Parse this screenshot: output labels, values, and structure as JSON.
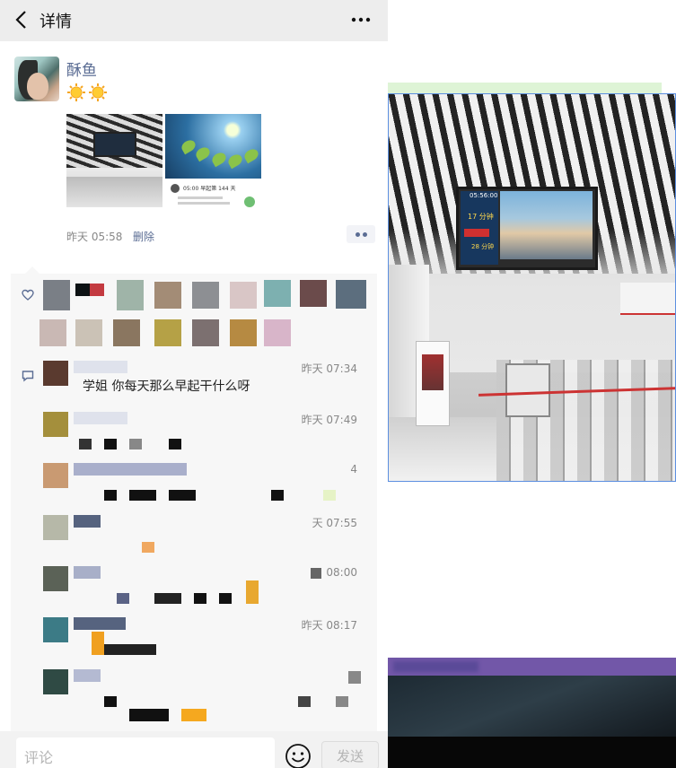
{
  "nav": {
    "title": "详情"
  },
  "post": {
    "username": "酥鱼",
    "time": "昨天 05:58",
    "delete_label": "删除",
    "image2_caption": "05:00 早起第 144 天"
  },
  "viewer": {
    "tv_clock": "05:56:00",
    "tv_minutes": "17 分钟",
    "tv_minutes2": "28 分钟"
  },
  "comments": [
    {
      "time": "昨天 07:34",
      "text": "学姐 你每天那么早起干什么呀"
    },
    {
      "time": "昨天 07:49",
      "text": ""
    },
    {
      "time": "4",
      "text": ""
    },
    {
      "time": "天 07:55",
      "text": ""
    },
    {
      "time": "08:00",
      "text": ""
    },
    {
      "time": "昨天 08:17",
      "text": ""
    },
    {
      "time": "",
      "text": ""
    }
  ],
  "input": {
    "placeholder": "评论",
    "send_label": "发送"
  },
  "colors": {
    "link": "#5b6d94",
    "nav_bg": "#ededed",
    "comment_bg": "#f7f7f7",
    "viewer_border": "#5c8fe0"
  },
  "icons": [
    "back-arrow-icon",
    "more-icon",
    "sun-icon",
    "heart-icon",
    "comment-icon",
    "emoji-icon"
  ]
}
